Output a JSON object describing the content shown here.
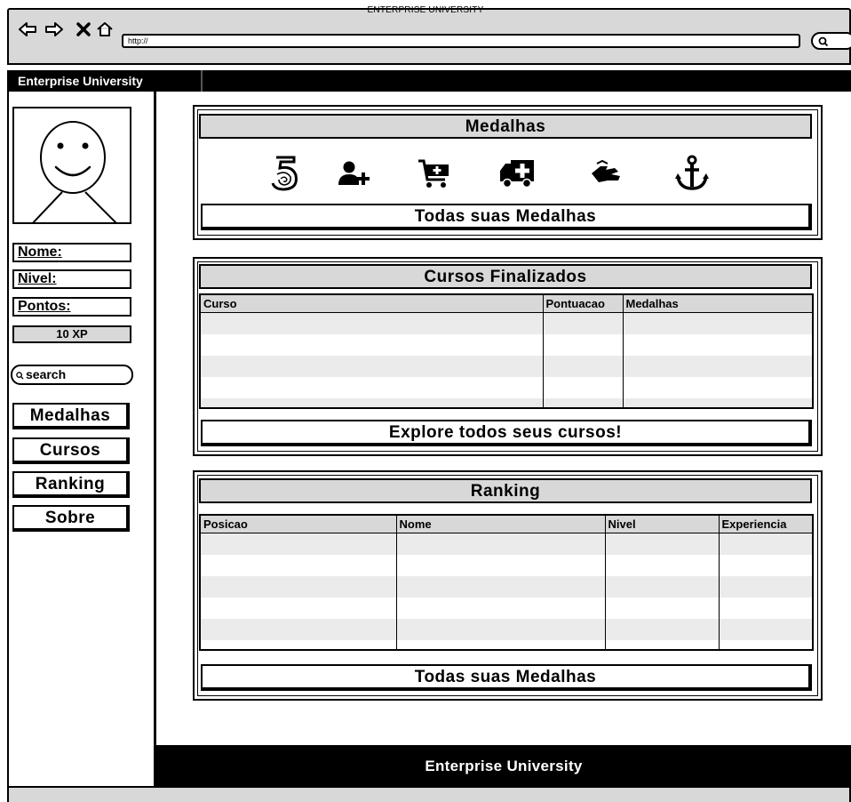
{
  "browser": {
    "window_title": "ENTERPRISE UNIVERSITY",
    "url": "http://",
    "back_icon": "arrow-left-icon",
    "forward_icon": "arrow-right-icon",
    "stop_icon": "close-icon",
    "home_icon": "home-icon",
    "search_icon": "search-icon"
  },
  "header": {
    "brand": "Enterprise University"
  },
  "sidebar": {
    "nome_label": "Nome:",
    "nivel_label": "Nivel:",
    "pontos_label": "Pontos:",
    "xp": "10 XP",
    "search_placeholder": "search",
    "nav": [
      "Medalhas",
      "Cursos",
      "Ranking",
      "Sobre"
    ]
  },
  "medalhas": {
    "title": "Medalhas",
    "icons": [
      "five-badge-icon",
      "add-user-icon",
      "cart-plus-icon",
      "ambulance-icon",
      "sign-language-icon",
      "anchor-icon"
    ],
    "button": "Todas suas Medalhas"
  },
  "cursos": {
    "title": "Cursos Finalizados",
    "columns": [
      "Curso",
      "Pontuacao",
      "Medalhas"
    ],
    "rows": 5,
    "button": "Explore todos seus cursos!"
  },
  "ranking": {
    "title": "Ranking",
    "columns": [
      "Posicao",
      "Nome",
      "Nivel",
      "Experiencia"
    ],
    "rows": 6,
    "button": "Todas suas Medalhas"
  },
  "footer": {
    "text": "Enterprise University"
  },
  "colors": {
    "chrome_gray": "#d8d8d8",
    "black": "#000000",
    "row_stripe": "#ebebeb"
  }
}
